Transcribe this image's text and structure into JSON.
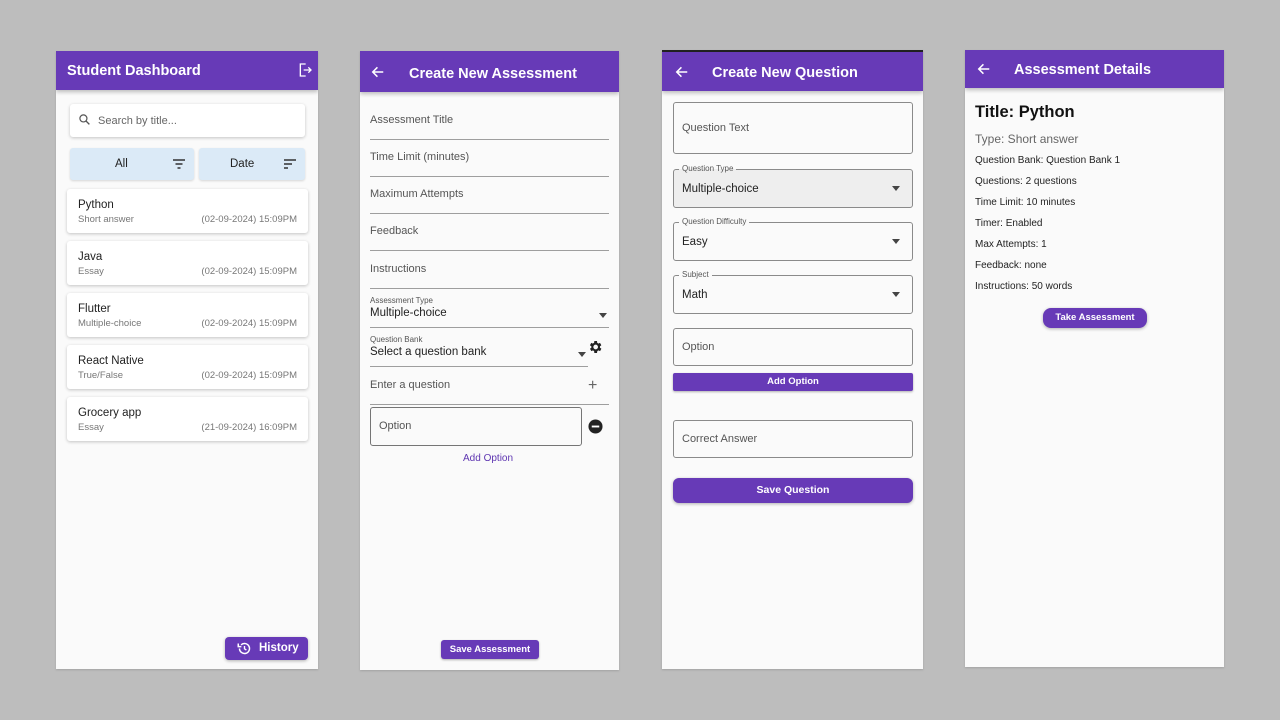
{
  "colors": {
    "primary": "#673ab7",
    "background": "#bdbdbd",
    "filter": "#dbeaf7"
  },
  "dashboard": {
    "title": "Student Dashboard",
    "logout_icon": "logout-icon",
    "search_placeholder": "Search by title...",
    "filter_all": "All",
    "filter_date": "Date",
    "items": [
      {
        "title": "Python",
        "type": "Short answer",
        "date": "(02-09-2024) 15:09PM"
      },
      {
        "title": "Java",
        "type": "Essay",
        "date": "(02-09-2024) 15:09PM"
      },
      {
        "title": "Flutter",
        "type": "Multiple-choice",
        "date": "(02-09-2024) 15:09PM"
      },
      {
        "title": "React Native",
        "type": "True/False",
        "date": "(02-09-2024) 15:09PM"
      },
      {
        "title": "Grocery app",
        "type": "Essay",
        "date": "(21-09-2024) 16:09PM"
      }
    ],
    "history_label": "History"
  },
  "create_assessment": {
    "title": "Create New Assessment",
    "fields": {
      "assessment_title": "Assessment Title",
      "time_limit": "Time Limit (minutes)",
      "max_attempts": "Maximum Attempts",
      "feedback": "Feedback",
      "instructions": "Instructions"
    },
    "assessment_type": {
      "label": "Assessment Type",
      "value": "Multiple-choice"
    },
    "question_bank": {
      "label": "Question Bank",
      "value": "Select a question bank"
    },
    "enter_question": "Enter a question",
    "option_placeholder": "Option",
    "add_option": "Add Option",
    "save": "Save Assessment"
  },
  "create_question": {
    "title": "Create New Question",
    "question_text": "Question Text",
    "question_type": {
      "label": "Question Type",
      "value": "Multiple-choice"
    },
    "difficulty": {
      "label": "Question Difficulty",
      "value": "Easy"
    },
    "subject": {
      "label": "Subject",
      "value": "Math"
    },
    "option_placeholder": "Option",
    "add_option": "Add Option",
    "correct_answer": "Correct Answer",
    "save": "Save Question"
  },
  "assessment_details": {
    "title": "Assessment Details",
    "heading": "Title: Python",
    "type": "Type: Short answer",
    "question_bank": "Question Bank: Question Bank 1",
    "questions": "Questions: 2 questions",
    "time_limit": "Time Limit: 10 minutes",
    "timer": "Timer: Enabled",
    "max_attempts": "Max Attempts: 1",
    "feedback": "Feedback: none",
    "instructions": "Instructions: 50 words",
    "take_button": "Take Assessment"
  }
}
